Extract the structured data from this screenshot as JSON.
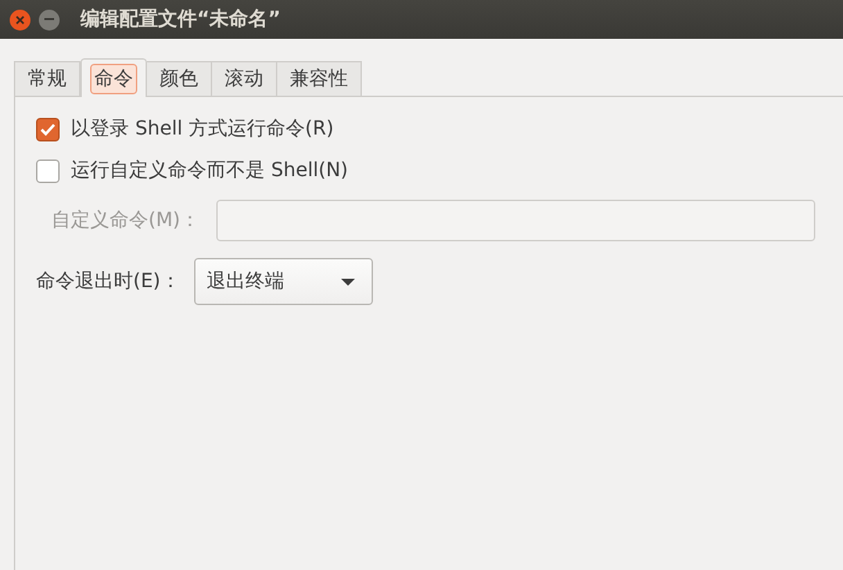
{
  "window": {
    "title": "编辑配置文件“未命名”"
  },
  "tabs": [
    {
      "label": "常规",
      "selected": false
    },
    {
      "label": "命令",
      "selected": true
    },
    {
      "label": "颜色",
      "selected": false
    },
    {
      "label": "滚动",
      "selected": false
    },
    {
      "label": "兼容性",
      "selected": false
    }
  ],
  "options": [
    {
      "label": "以登录 Shell 方式运行命令(R)",
      "checked": true
    },
    {
      "label": "运行自定义命令而不是 Shell(N)",
      "checked": false
    }
  ],
  "custom_command": {
    "label": "自定义命令(M)：",
    "disabled": true
  },
  "on_exit": {
    "label": "命令退出时(E)：",
    "value": "退出终端"
  }
}
